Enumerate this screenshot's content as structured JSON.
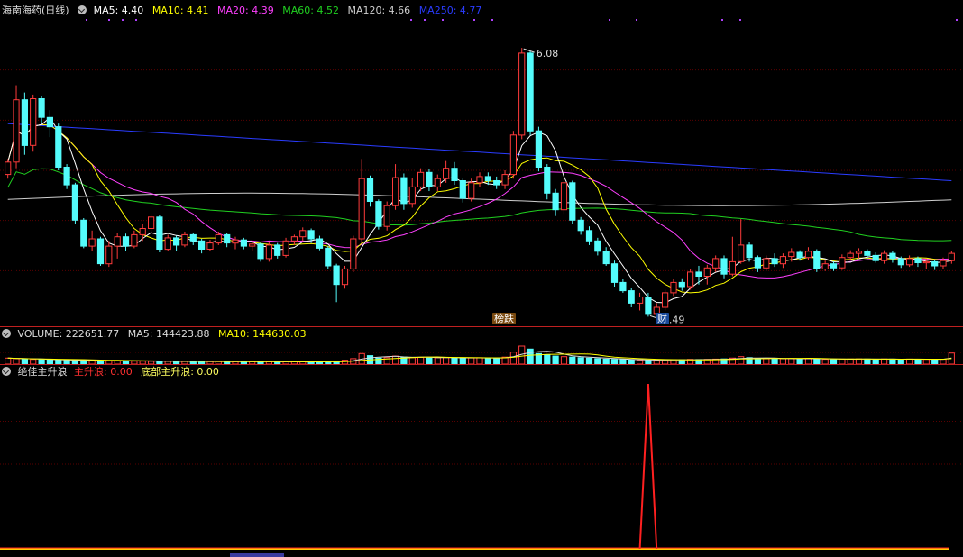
{
  "header": {
    "stock_name": "海南海药(日线)",
    "ma": [
      {
        "label": "MA5: 4.40",
        "color": "#ffffff"
      },
      {
        "label": "MA10: 4.41",
        "color": "#ffff00"
      },
      {
        "label": "MA20: 4.39",
        "color": "#ff40ff"
      },
      {
        "label": "MA60: 4.52",
        "color": "#20d020"
      },
      {
        "label": "MA120: 4.66",
        "color": "#cfcfcf"
      },
      {
        "label": "MA250: 4.77",
        "color": "#2a3cff"
      }
    ]
  },
  "volume_header": {
    "volume": "VOLUME: 222651.77",
    "ma5": "MA5: 144423.88",
    "ma10": "MA10: 144630.03"
  },
  "indicator_header": {
    "name": "绝佳主升浪",
    "main": "主升浪: 0.00",
    "bottom": "底部主升浪: 0.00"
  },
  "tags": {
    "bang": "榜跌",
    "cai": "财"
  },
  "colors": {
    "up": "#ff3b3b",
    "down": "#54fcfc",
    "ma5": "#ffffff",
    "ma10": "#ffff00",
    "ma20": "#ff40ff",
    "ma60": "#20d020",
    "ma120": "#cfcfcf",
    "ma250": "#2a3cff",
    "signal": "#ff2020",
    "divider": "#c02020"
  },
  "chart_data": {
    "type": "candlestick",
    "high_label": "6.08",
    "low_label": "3.49",
    "price_range": [
      3.45,
      6.35
    ],
    "candles": [
      [
        4.86,
        4.98,
        5.01,
        4.82
      ],
      [
        4.98,
        5.58,
        5.72,
        4.92
      ],
      [
        5.58,
        5.14,
        5.65,
        5.05
      ],
      [
        5.14,
        5.59,
        5.63,
        5.08
      ],
      [
        5.59,
        5.41,
        5.62,
        5.35
      ],
      [
        5.41,
        5.32,
        5.48,
        5.22
      ],
      [
        5.32,
        4.93,
        5.35,
        4.9
      ],
      [
        4.93,
        4.76,
        4.96,
        4.72
      ],
      [
        4.76,
        4.42,
        4.78,
        4.38
      ],
      [
        4.42,
        4.17,
        4.44,
        4.15
      ],
      [
        4.17,
        4.24,
        4.32,
        4.12
      ],
      [
        4.24,
        4.0,
        4.26,
        3.98
      ],
      [
        4.0,
        4.17,
        4.22,
        3.97
      ],
      [
        4.17,
        4.26,
        4.3,
        4.05
      ],
      [
        4.26,
        4.17,
        4.29,
        4.12
      ],
      [
        4.17,
        4.28,
        4.32,
        4.15
      ],
      [
        4.28,
        4.34,
        4.38,
        4.22
      ],
      [
        4.34,
        4.45,
        4.48,
        4.3
      ],
      [
        4.45,
        4.14,
        4.47,
        4.11
      ],
      [
        4.14,
        4.25,
        4.28,
        4.12
      ],
      [
        4.25,
        4.18,
        4.27,
        4.12
      ],
      [
        4.18,
        4.28,
        4.31,
        4.16
      ],
      [
        4.28,
        4.22,
        4.3,
        4.18
      ],
      [
        4.22,
        4.14,
        4.24,
        4.1
      ],
      [
        4.14,
        4.2,
        4.23,
        4.12
      ],
      [
        4.2,
        4.28,
        4.31,
        4.18
      ],
      [
        4.28,
        4.2,
        4.3,
        4.16
      ],
      [
        4.2,
        4.23,
        4.26,
        4.14
      ],
      [
        4.23,
        4.17,
        4.25,
        4.14
      ],
      [
        4.17,
        4.19,
        4.22,
        4.12
      ],
      [
        4.19,
        4.05,
        4.21,
        4.02
      ],
      [
        4.05,
        4.18,
        4.21,
        4.02
      ],
      [
        4.18,
        4.08,
        4.2,
        4.05
      ],
      [
        4.08,
        4.22,
        4.25,
        4.06
      ],
      [
        4.22,
        4.26,
        4.28,
        4.18
      ],
      [
        4.26,
        4.32,
        4.35,
        4.22
      ],
      [
        4.32,
        4.24,
        4.34,
        4.2
      ],
      [
        4.24,
        4.15,
        4.27,
        4.13
      ],
      [
        4.15,
        3.98,
        4.17,
        3.95
      ],
      [
        3.98,
        3.8,
        4.0,
        3.63
      ],
      [
        3.8,
        3.95,
        3.98,
        3.76
      ],
      [
        3.95,
        4.24,
        4.27,
        3.92
      ],
      [
        4.24,
        4.82,
        5.01,
        4.2
      ],
      [
        4.82,
        4.6,
        4.85,
        4.55
      ],
      [
        4.6,
        4.36,
        4.62,
        4.33
      ],
      [
        4.36,
        4.56,
        4.6,
        4.32
      ],
      [
        4.56,
        4.83,
        4.96,
        4.52
      ],
      [
        4.83,
        4.58,
        4.87,
        4.52
      ],
      [
        4.58,
        4.74,
        4.83,
        4.54
      ],
      [
        4.74,
        4.88,
        4.92,
        4.7
      ],
      [
        4.88,
        4.74,
        4.91,
        4.7
      ],
      [
        4.74,
        4.82,
        4.86,
        4.7
      ],
      [
        4.82,
        4.92,
        4.99,
        4.78
      ],
      [
        4.92,
        4.8,
        4.98,
        4.76
      ],
      [
        4.8,
        4.63,
        4.82,
        4.59
      ],
      [
        4.63,
        4.78,
        4.82,
        4.6
      ],
      [
        4.78,
        4.84,
        4.88,
        4.74
      ],
      [
        4.84,
        4.8,
        4.88,
        4.76
      ],
      [
        4.8,
        4.76,
        4.84,
        4.72
      ],
      [
        4.76,
        4.86,
        4.9,
        4.72
      ],
      [
        4.86,
        5.24,
        5.28,
        4.82
      ],
      [
        5.24,
        6.03,
        6.08,
        5.2
      ],
      [
        6.03,
        5.28,
        6.05,
        5.24
      ],
      [
        5.28,
        4.93,
        5.32,
        4.89
      ],
      [
        4.93,
        4.68,
        4.96,
        4.62
      ],
      [
        4.68,
        4.52,
        4.72,
        4.46
      ],
      [
        4.52,
        4.78,
        4.82,
        4.48
      ],
      [
        4.78,
        4.42,
        4.8,
        4.38
      ],
      [
        4.42,
        4.32,
        4.45,
        4.28
      ],
      [
        4.32,
        4.22,
        4.36,
        4.18
      ],
      [
        4.22,
        4.12,
        4.25,
        4.08
      ],
      [
        4.12,
        4.0,
        4.16,
        3.98
      ],
      [
        4.0,
        3.82,
        4.03,
        3.78
      ],
      [
        3.82,
        3.74,
        3.85,
        3.72
      ],
      [
        3.74,
        3.62,
        3.77,
        3.58
      ],
      [
        3.62,
        3.68,
        3.72,
        3.55
      ],
      [
        3.68,
        3.52,
        3.72,
        3.49
      ],
      [
        3.52,
        3.58,
        3.62,
        3.5
      ],
      [
        3.58,
        3.72,
        3.75,
        3.55
      ],
      [
        3.72,
        3.82,
        3.85,
        3.69
      ],
      [
        3.82,
        3.78,
        3.86,
        3.74
      ],
      [
        3.78,
        3.92,
        3.95,
        3.75
      ],
      [
        3.92,
        3.88,
        3.98,
        3.8
      ],
      [
        3.88,
        3.96,
        3.99,
        3.8
      ],
      [
        3.96,
        4.05,
        4.08,
        3.92
      ],
      [
        4.05,
        3.9,
        4.08,
        3.86
      ],
      [
        3.9,
        4.02,
        4.26,
        3.88
      ],
      [
        4.02,
        4.18,
        4.43,
        4.0
      ],
      [
        4.18,
        4.06,
        4.21,
        4.02
      ],
      [
        4.06,
        3.96,
        4.08,
        3.92
      ],
      [
        3.96,
        4.05,
        4.08,
        3.93
      ],
      [
        4.05,
        4.0,
        4.1,
        3.97
      ],
      [
        4.0,
        4.07,
        4.1,
        3.96
      ],
      [
        4.07,
        4.11,
        4.15,
        4.02
      ],
      [
        4.11,
        4.06,
        4.13,
        4.03
      ],
      [
        4.06,
        4.12,
        4.16,
        4.04
      ],
      [
        4.12,
        3.95,
        4.14,
        3.92
      ],
      [
        3.95,
        4.0,
        4.03,
        3.93
      ],
      [
        4.0,
        3.96,
        4.02,
        3.93
      ],
      [
        3.96,
        4.06,
        4.09,
        3.94
      ],
      [
        4.06,
        4.1,
        4.13,
        4.04
      ],
      [
        4.1,
        4.12,
        4.15,
        4.05
      ],
      [
        4.12,
        4.08,
        4.14,
        4.05
      ],
      [
        4.08,
        4.03,
        4.11,
        4.01
      ],
      [
        4.03,
        4.1,
        4.13,
        4.0
      ],
      [
        4.1,
        4.05,
        4.12,
        4.01
      ],
      [
        4.05,
        3.99,
        4.07,
        3.96
      ],
      [
        3.99,
        4.05,
        4.08,
        3.97
      ],
      [
        4.05,
        4.01,
        4.07,
        3.97
      ],
      [
        4.01,
        4.02,
        4.05,
        3.95
      ],
      [
        4.02,
        3.98,
        4.04,
        3.94
      ],
      [
        3.98,
        4.03,
        4.06,
        3.95
      ],
      [
        4.03,
        4.1,
        4.12,
        4.0
      ]
    ],
    "volume": [
      120,
      110,
      100,
      95,
      90,
      85,
      80,
      78,
      75,
      72,
      70,
      68,
      66,
      64,
      62,
      60,
      60,
      58,
      56,
      55,
      54,
      53,
      52,
      52,
      51,
      50,
      50,
      49,
      48,
      48,
      47,
      47,
      46,
      46,
      45,
      45,
      46,
      47,
      48,
      60,
      80,
      110,
      210,
      170,
      120,
      130,
      160,
      140,
      130,
      135,
      125,
      128,
      132,
      125,
      118,
      125,
      128,
      122,
      118,
      140,
      240,
      360,
      300,
      210,
      180,
      160,
      150,
      140,
      130,
      120,
      110,
      100,
      95,
      90,
      85,
      82,
      80,
      78,
      85,
      90,
      88,
      95,
      92,
      96,
      100,
      105,
      120,
      150,
      130,
      110,
      108,
      105,
      110,
      112,
      108,
      110,
      100,
      98,
      96,
      100,
      102,
      104,
      100,
      98,
      102,
      100,
      98,
      100,
      98,
      96,
      95,
      98,
      222
    ],
    "indicator": {
      "spike_index": 76,
      "series": [
        {
          "name": "主升浪"
        },
        {
          "name": "底部主升浪"
        }
      ]
    }
  }
}
